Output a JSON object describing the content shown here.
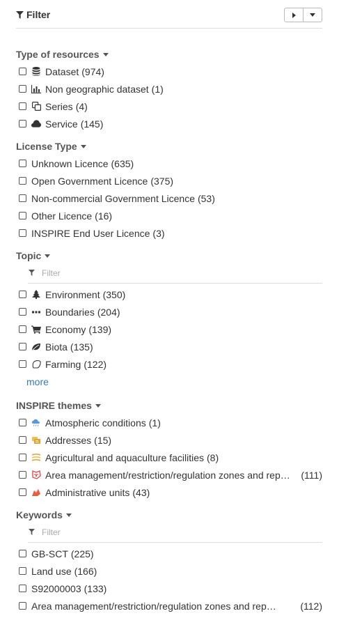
{
  "header": {
    "title": "Filter"
  },
  "resources": {
    "title": "Type of resources",
    "items": [
      {
        "label": "Dataset",
        "count": "(974)",
        "icon": "database-icon"
      },
      {
        "label": "Non geographic dataset",
        "count": "(1)",
        "icon": "bar-chart-icon"
      },
      {
        "label": "Series",
        "count": "(4)",
        "icon": "copy-icon"
      },
      {
        "label": "Service",
        "count": "(145)",
        "icon": "cloud-icon"
      }
    ]
  },
  "license": {
    "title": "License Type",
    "items": [
      {
        "label": "Unknown Licence",
        "count": "(635)"
      },
      {
        "label": "Open Government Licence",
        "count": "(375)"
      },
      {
        "label": "Non-commercial Government Licence",
        "count": "(53)"
      },
      {
        "label": "Other Licence",
        "count": "(16)"
      },
      {
        "label": "INSPIRE End User Licence",
        "count": "(3)"
      }
    ]
  },
  "topic": {
    "title": "Topic",
    "filter_placeholder": "Filter",
    "items": [
      {
        "label": "Environment",
        "count": "(350)",
        "icon": "tree-icon"
      },
      {
        "label": "Boundaries",
        "count": "(204)",
        "icon": "ellipsis-icon"
      },
      {
        "label": "Economy",
        "count": "(139)",
        "icon": "cart-icon"
      },
      {
        "label": "Biota",
        "count": "(135)",
        "icon": "leaf-icon"
      },
      {
        "label": "Farming",
        "count": "(122)",
        "icon": "field-icon"
      }
    ],
    "more_label": "more"
  },
  "inspire": {
    "title": "INSPIRE themes",
    "items": [
      {
        "label": "Atmospheric conditions",
        "count": "(1)",
        "icon": "weather-icon"
      },
      {
        "label": "Addresses",
        "count": "(15)",
        "icon": "address-icon"
      },
      {
        "label": "Agricultural and aquaculture facilities",
        "count": "(8)",
        "icon": "agriculture-icon"
      },
      {
        "label": "Area management/restriction/regulation zones and reporting units",
        "count": "(111)",
        "icon": "area-management-icon"
      },
      {
        "label": "Administrative units",
        "count": "(43)",
        "icon": "administrative-units-icon"
      }
    ]
  },
  "keywords": {
    "title": "Keywords",
    "filter_placeholder": "Filter",
    "items": [
      {
        "label": "GB-SCT",
        "count": "(225)"
      },
      {
        "label": "Land use",
        "count": "(166)"
      },
      {
        "label": "S92000003",
        "count": "(133)"
      },
      {
        "label": "Area management/restriction/regulation zones and reporting units",
        "count": "(112)"
      }
    ]
  },
  "colors": {
    "link": "#337ab7",
    "text": "#333333",
    "section_title": "#555555",
    "divider": "#dddddd"
  }
}
